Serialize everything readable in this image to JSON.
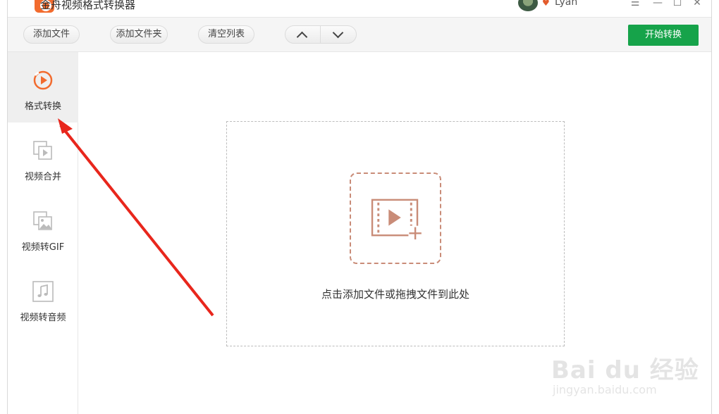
{
  "window": {
    "title": "金舟视频格式转换器",
    "user": "Lyan"
  },
  "toolbar": {
    "add_file": "添加文件",
    "add_folder": "添加文件夹",
    "clear_list": "清空列表",
    "start": "开始转换"
  },
  "sidebar": {
    "items": [
      {
        "label": "格式转换",
        "icon": "play-circle-icon",
        "active": true
      },
      {
        "label": "视频合并",
        "icon": "video-merge-icon",
        "active": false
      },
      {
        "label": "视频转GIF",
        "icon": "image-gif-icon",
        "active": false
      },
      {
        "label": "视频转音频",
        "icon": "music-note-icon",
        "active": false
      }
    ]
  },
  "main": {
    "drop_hint": "点击添加文件或拖拽文件到此处"
  },
  "watermark": {
    "brand": "Bai du 经验",
    "url": "jingyan.baidu.com"
  },
  "colors": {
    "accent_orange": "#f26b2e",
    "start_green": "#16a34a",
    "drop_icon": "#c98c78",
    "annotation_red": "#e8261c"
  }
}
